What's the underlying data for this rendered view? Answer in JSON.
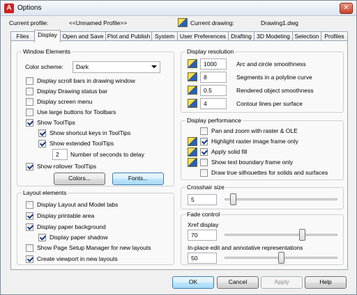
{
  "window": {
    "title": "Options",
    "app_icon": "A",
    "close_glyph": "✕"
  },
  "profile": {
    "label": "Current profile:",
    "value": "<<Unnamed Profile>>"
  },
  "drawing": {
    "label": "Current drawing:",
    "value": "Drawing1.dwg"
  },
  "tabs": [
    "Files",
    "Display",
    "Open and Save",
    "Plot and Publish",
    "System",
    "User Preferences",
    "Drafting",
    "3D Modeling",
    "Selection",
    "Profiles"
  ],
  "active_tab": "Display",
  "window_elements": {
    "title": "Window Elements",
    "color_scheme_label": "Color scheme:",
    "color_scheme_value": "Dark",
    "options": [
      {
        "label": "Display scroll bars in drawing window",
        "checked": false
      },
      {
        "label": "Display Drawing status bar",
        "checked": false
      },
      {
        "label": "Display screen menu",
        "checked": false
      },
      {
        "label": "Use large buttons for Toolbars",
        "checked": false
      },
      {
        "label": "Show ToolTips",
        "checked": true
      },
      {
        "label": "Show shortcut keys in ToolTips",
        "checked": true
      },
      {
        "label": "Show extended ToolTips",
        "checked": true
      },
      {
        "label": "Show rollover ToolTips",
        "checked": true
      }
    ],
    "seconds_value": "2",
    "seconds_label": "Number of seconds to delay",
    "colors_button": "Colors...",
    "fonts_button": "Fonts..."
  },
  "layout_elements": {
    "title": "Layout elements",
    "options": [
      {
        "label": "Display Layout and Model tabs",
        "checked": false
      },
      {
        "label": "Display printable area",
        "checked": true
      },
      {
        "label": "Display paper background",
        "checked": true
      },
      {
        "label": "Display paper shadow",
        "checked": true
      },
      {
        "label": "Show Page Setup Manager for new layouts",
        "checked": false
      },
      {
        "label": "Create viewport in new layouts",
        "checked": true
      }
    ]
  },
  "display_resolution": {
    "title": "Display resolution",
    "rows": [
      {
        "value": "1000",
        "label": "Arc and circle smoothness"
      },
      {
        "value": "8",
        "label": "Segments in a polyline curve"
      },
      {
        "value": "0.5",
        "label": "Rendered object smoothness"
      },
      {
        "value": "4",
        "label": "Contour lines per surface"
      }
    ]
  },
  "display_performance": {
    "title": "Display performance",
    "options": [
      {
        "label": "Pan and zoom with raster & OLE",
        "checked": false
      },
      {
        "label": "Highlight raster image frame only",
        "checked": true
      },
      {
        "label": "Apply solid fill",
        "checked": true
      },
      {
        "label": "Show text boundary frame only",
        "checked": false
      },
      {
        "label": "Draw true silhouettes for solids and surfaces",
        "checked": false
      }
    ]
  },
  "crosshair": {
    "title": "Crosshair size",
    "value": "5",
    "slider_fraction": 0.05
  },
  "fade": {
    "title": "Fade control",
    "xref_label": "Xref display",
    "xref_value": "70",
    "xref_fraction": 0.7,
    "inplace_label": "In-place edit and annotative representations",
    "inplace_value": "50",
    "inplace_fraction": 0.5
  },
  "buttons": {
    "ok": "OK",
    "cancel": "Cancel",
    "apply": "Apply",
    "help": "Help"
  },
  "colors": {
    "accent": "#3c7fb1",
    "close": "#c7432b"
  }
}
